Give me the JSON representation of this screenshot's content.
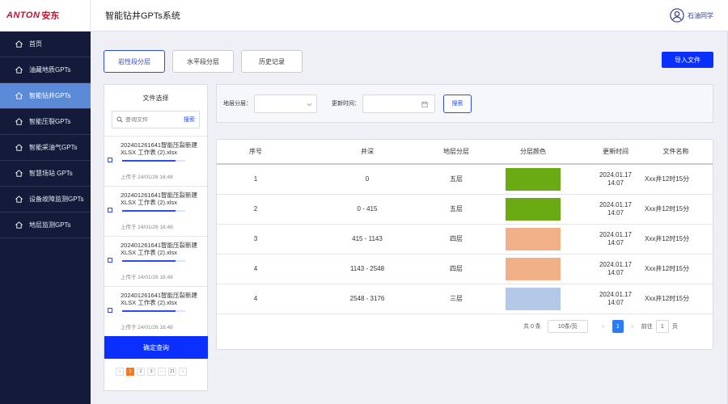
{
  "logo": {
    "en": "ANTON",
    "cn": "安东"
  },
  "header": {
    "title": "智能钻井GPTs系统",
    "user": "石油同学"
  },
  "sidebar": {
    "items": [
      {
        "label": "首页",
        "active": false
      },
      {
        "label": "油藏地质GPTs",
        "active": false
      },
      {
        "label": "智能钻井GPTs",
        "active": true
      },
      {
        "label": "智能压裂GPTs",
        "active": false
      },
      {
        "label": "智能采油气GPTs",
        "active": false
      },
      {
        "label": "智慧场站 GPTs",
        "active": false
      },
      {
        "label": "设备故障监测GPTs",
        "active": false
      },
      {
        "label": "地层监测GPTs",
        "active": false
      }
    ]
  },
  "tabs": [
    {
      "label": "岩性段分层",
      "active": true
    },
    {
      "label": "水平段分层",
      "active": false
    },
    {
      "label": "历史记录",
      "active": false
    }
  ],
  "import_label": "导入文件",
  "filepanel": {
    "title": "文件选择",
    "search_placeholder": "查询文件",
    "search_btn": "搜索",
    "files": [
      {
        "name": "202401261641智能压裂新建 XLSX 工作表 (2).xlsx",
        "time": "上传于 24/01/26 16:48",
        "progress": 0.85
      },
      {
        "name": "202401261641智能压裂新建 XLSX 工作表 (2).xlsx",
        "time": "上传于 24/01/26 16:48",
        "progress": 0.85
      },
      {
        "name": "202401261641智能压裂新建 XLSX 工作表 (2).xlsx",
        "time": "上传于 24/01/26 16:48",
        "progress": 0.85
      },
      {
        "name": "202401261641智能压裂新建 XLSX 工作表 (2).xlsx",
        "time": "上传于 24/01/26 16:48",
        "progress": 0.85
      }
    ],
    "confirm": "确定查询",
    "pages": [
      "‹",
      "1",
      "2",
      "3",
      "···",
      "21",
      "›"
    ],
    "current_page": "1"
  },
  "filters": {
    "layer_label": "地层分层：",
    "time_label": "更新时间：",
    "search": "搜索"
  },
  "table": {
    "headers": [
      "序号",
      "井深",
      "地层分层",
      "分层颜色",
      "更新时间",
      "文件名称"
    ],
    "rows": [
      {
        "no": "1",
        "depth": "0",
        "layer": "五层",
        "color": "#6aaa12",
        "date": "2024.01.17",
        "time": "14:07",
        "file": "Xxx井12时15分"
      },
      {
        "no": "2",
        "depth": "0 - 415",
        "layer": "五层",
        "color": "#6aaa12",
        "date": "2024.01.17",
        "time": "14:07",
        "file": "Xxx井12时15分"
      },
      {
        "no": "3",
        "depth": "415 - 1143",
        "layer": "四层",
        "color": "#f2b088",
        "date": "2024.01.17",
        "time": "14:07",
        "file": "Xxx井12时15分"
      },
      {
        "no": "4",
        "depth": "1143 - 2548",
        "layer": "四层",
        "color": "#f2b088",
        "date": "2024.01.17",
        "time": "14:07",
        "file": "Xxx井12时15分"
      },
      {
        "no": "4",
        "depth": "2548 - 3176",
        "layer": "三层",
        "color": "#b4c8e8",
        "date": "2024.01.17",
        "time": "14:07",
        "file": "Xxx井12时15分"
      }
    ]
  },
  "pager": {
    "total": "共 0 条",
    "size": "10条/页",
    "prev": "‹",
    "page": "1",
    "next": "›",
    "goto": "前往",
    "goto_val": "1",
    "unit": "页"
  },
  "colors": {
    "sidebar": "#141b3a",
    "accent": "#0a2fff",
    "active_nav": "#5b8ad8"
  }
}
